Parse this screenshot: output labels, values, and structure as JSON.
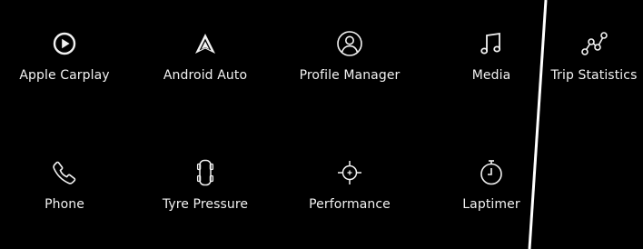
{
  "screen": {
    "background": "#000000",
    "text_color": "#f2f2f2",
    "divider_color": "#ffffff"
  },
  "tiles": [
    {
      "label": "Apple Carplay",
      "icon": "play-circle-icon"
    },
    {
      "label": "Android Auto",
      "icon": "android-auto-arrow-icon"
    },
    {
      "label": "Profile Manager",
      "icon": "user-circle-icon"
    },
    {
      "label": "Media",
      "icon": "music-note-icon"
    },
    {
      "label": "Trip Statistics",
      "icon": "route-graph-icon"
    },
    {
      "label": "Phone",
      "icon": "phone-icon"
    },
    {
      "label": "Tyre Pressure",
      "icon": "car-tyres-icon"
    },
    {
      "label": "Performance",
      "icon": "crosshair-icon"
    },
    {
      "label": "Laptimer",
      "icon": "stopwatch-icon"
    }
  ]
}
